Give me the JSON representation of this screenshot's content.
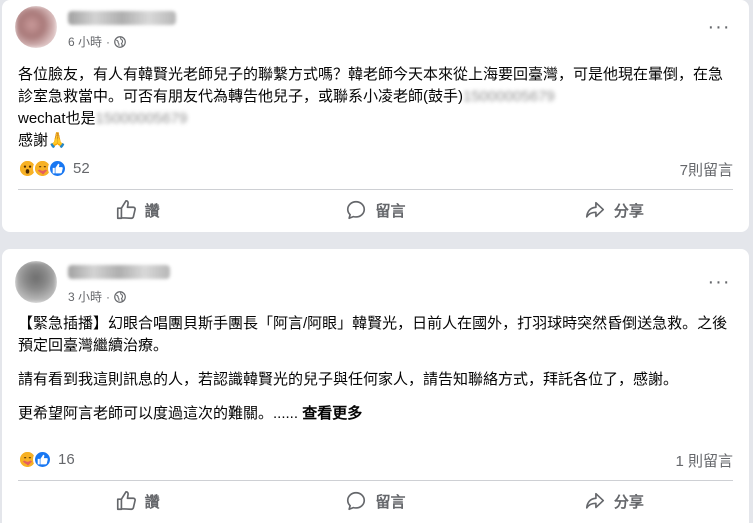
{
  "colors": {
    "feed_background": "#e4e6eb",
    "card_background": "#ffffff",
    "secondary_text": "#65676b",
    "like_blue": "#1877f2",
    "reaction_yellow": "#f7b125"
  },
  "posts": [
    {
      "time": "6 小時",
      "privacy_icon": "globe-icon",
      "paragraphs": [
        {
          "text": "各位臉友，有人有韓賢光老師兒子的聯繫方式嗎？韓老師今天本來從上海要回臺灣，可是他現在暈倒，在急診室急救當中。可否有朋友代為轉告他兒子，或聯系小凌老師(鼓手)",
          "blurred": "15000005679"
        },
        {
          "text": "wechat也是",
          "blurred": "15000005679"
        },
        {
          "text": "感謝🙏",
          "blurred": ""
        }
      ],
      "reactions": [
        "wow",
        "care",
        "like"
      ],
      "reaction_count": "52",
      "comment_count": "7則留言",
      "actions": {
        "like": "讚",
        "comment": "留言",
        "share": "分享"
      }
    },
    {
      "time": "3 小時",
      "privacy_icon": "globe-icon",
      "paragraphs": [
        {
          "text": "【緊急插播】幻眼合唱團貝斯手團長「阿言/阿眼」韓賢光，日前人在國外，打羽球時突然昏倒送急救。之後預定回臺灣繼續治療。"
        },
        {
          "text": "請有看到我這則訊息的人，若認識韓賢光的兒子與任何家人，請告知聯絡方式，拜託各位了，感謝。"
        },
        {
          "text": "更希望阿言老師可以度過這次的難關。......",
          "see_more": "查看更多"
        }
      ],
      "reactions": [
        "care",
        "like"
      ],
      "reaction_count": "16",
      "comment_count": "1 則留言",
      "actions": {
        "like": "讚",
        "comment": "留言",
        "share": "分享"
      }
    }
  ]
}
